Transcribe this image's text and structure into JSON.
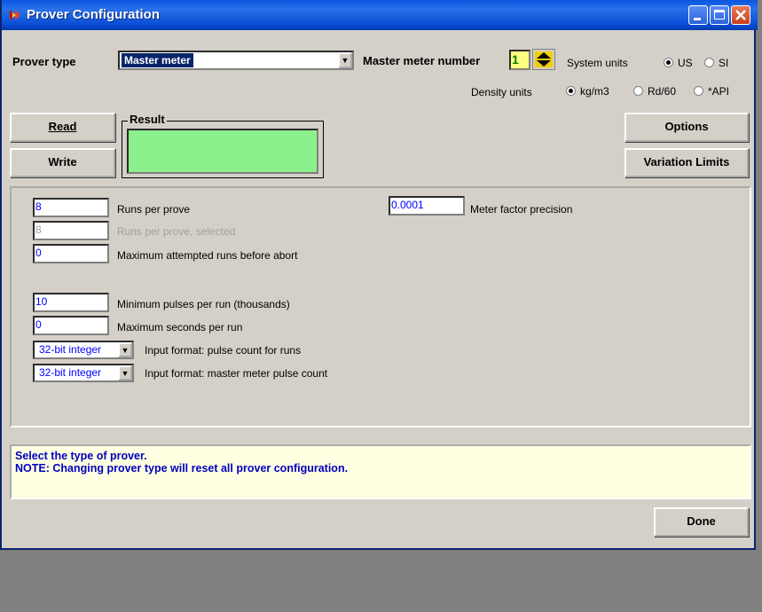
{
  "window": {
    "title": "Prover Configuration"
  },
  "header": {
    "prover_type_label": "Prover type",
    "prover_type_value": "Master meter",
    "master_meter_number_label": "Master meter number",
    "master_meter_number_value": "1",
    "system_units_label": "System units",
    "system_units_options": [
      "US",
      "SI"
    ],
    "system_units_selected": "US",
    "density_units_label": "Density units",
    "density_units_options": [
      "kg/m3",
      "Rd/60",
      "*API"
    ],
    "density_units_selected": "kg/m3"
  },
  "actions": {
    "read_label": "Read",
    "write_label": "Write",
    "result_label": "Result",
    "result_color": "#8cf08c",
    "options_label": "Options",
    "variation_limits_label": "Variation Limits"
  },
  "fields": {
    "runs_per_prove": {
      "value": "8",
      "label": "Runs per prove"
    },
    "runs_per_prove_selected": {
      "value": "8",
      "label": "Runs per prove, selected"
    },
    "max_attempted_runs": {
      "value": "0",
      "label": "Maximum attempted runs before abort"
    },
    "meter_factor_precision": {
      "value": "0.0001",
      "label": "Meter factor precision"
    },
    "min_pulses_per_run": {
      "value": "10",
      "label": "Minimum pulses per run (thousands)"
    },
    "max_seconds_per_run": {
      "value": "0",
      "label": "Maximum seconds per run"
    },
    "input_format_runs": {
      "value": "32-bit integer",
      "label": "Input format: pulse count for runs"
    },
    "input_format_master": {
      "value": "32-bit integer",
      "label": "Input format: master meter pulse count"
    }
  },
  "note": {
    "line1": "Select the type of prover.",
    "line2": "NOTE: Changing prover type will reset all prover configuration."
  },
  "footer": {
    "done_label": "Done"
  }
}
